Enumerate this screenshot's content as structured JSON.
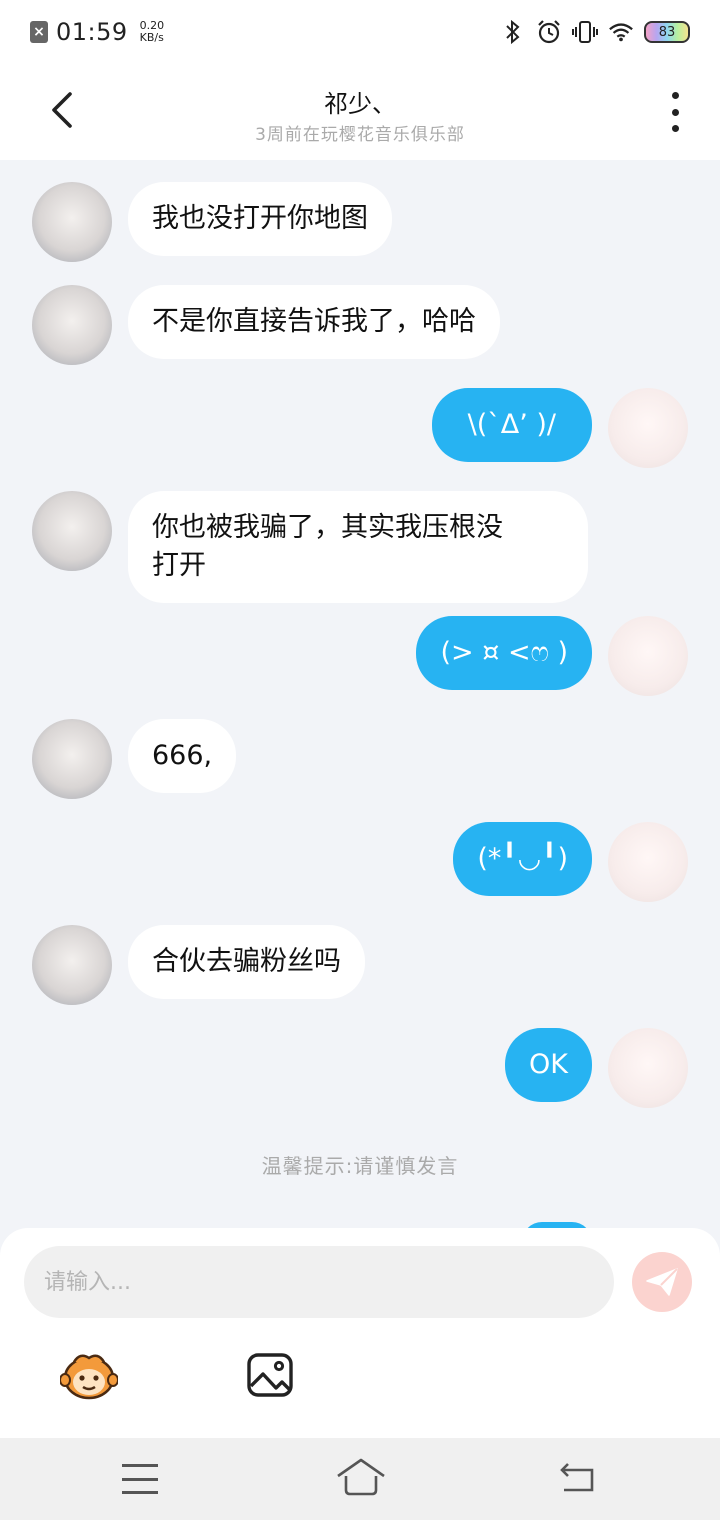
{
  "status_bar": {
    "time": "01:59",
    "speed_value": "0.20",
    "speed_unit": "KB/s",
    "battery": "83"
  },
  "header": {
    "title": "祁少、",
    "subtitle": "3周前在玩樱花音乐俱乐部"
  },
  "messages": [
    {
      "side": "other",
      "text": "我也没打开你地图"
    },
    {
      "side": "other",
      "text": "不是你直接告诉我了，哈哈"
    },
    {
      "side": "self",
      "text": "\\(`Δ’ )/"
    },
    {
      "side": "other",
      "text": "你也被我骗了，其实我压根没\n打开"
    },
    {
      "side": "self",
      "text": "(> ¤ <ෆ )"
    },
    {
      "side": "other",
      "text": "666,"
    },
    {
      "side": "self",
      "text": "(*╹◡╹)"
    },
    {
      "side": "other",
      "text": "合伙去骗粉丝吗"
    },
    {
      "side": "self",
      "text": "OK"
    }
  ],
  "notice": "温馨提示:请谨慎发言",
  "composer": {
    "placeholder": "请输入..."
  },
  "colors": {
    "self_bubble": "#27b3f2",
    "other_bubble": "#ffffff",
    "chat_background": "#f2f4f8",
    "send_button": "#fbd3cf"
  },
  "icons": [
    "back-arrow-icon",
    "more-icon",
    "send-icon",
    "emoji-icon",
    "image-icon",
    "menu-icon",
    "home-icon",
    "return-icon"
  ]
}
